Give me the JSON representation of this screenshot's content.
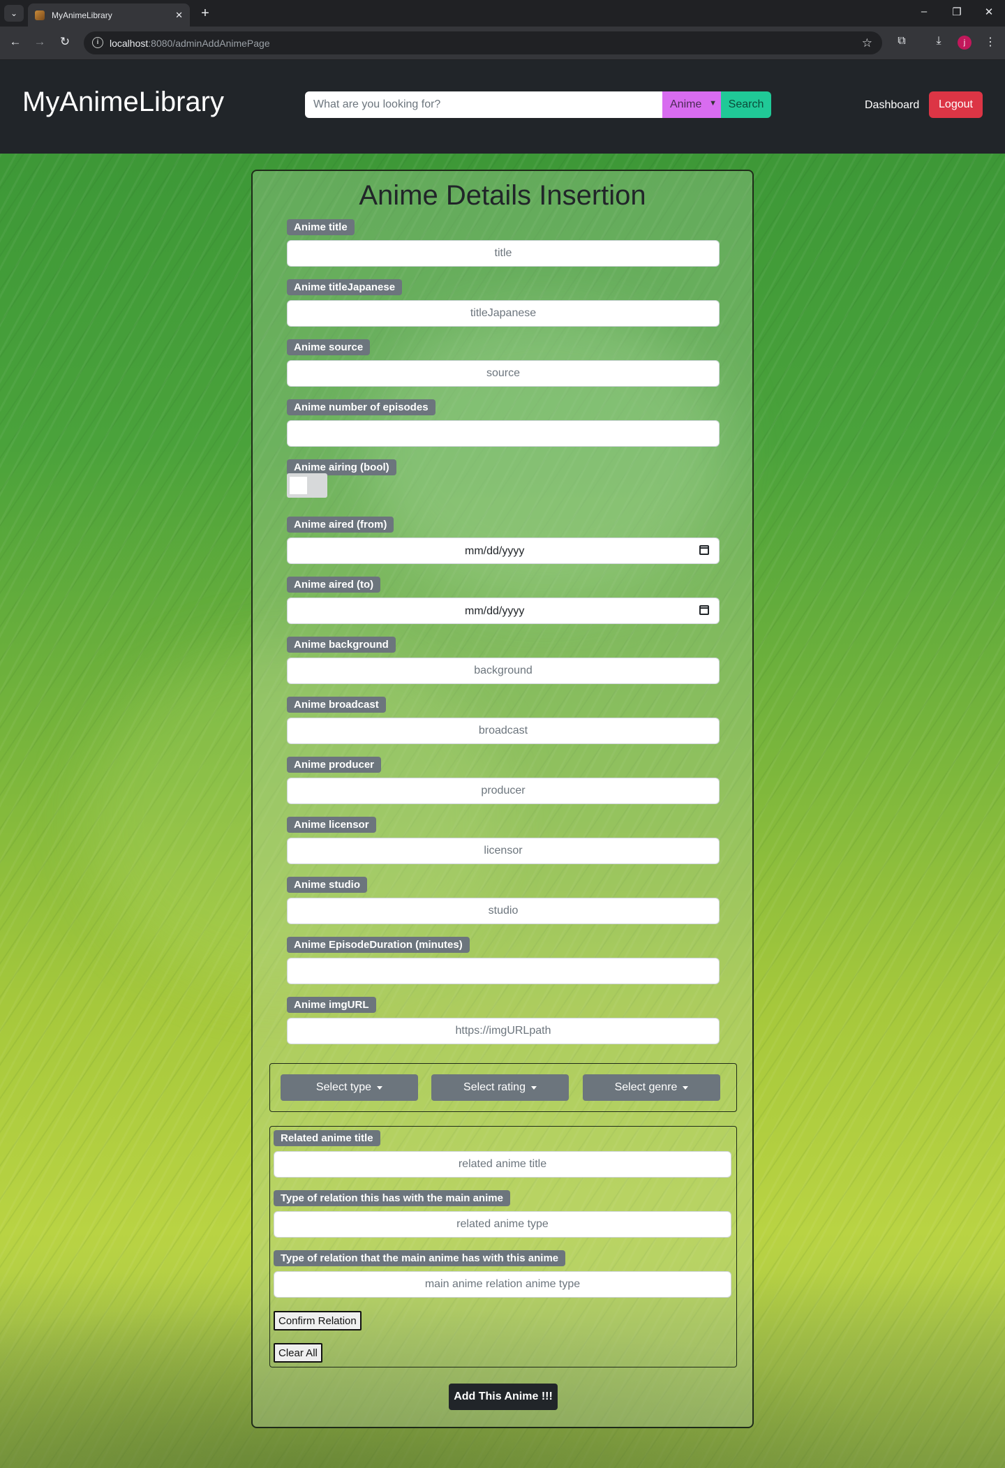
{
  "browser": {
    "tab_title": "MyAnimeLibrary",
    "url_host": "localhost",
    "url_rest": ":8080/adminAddAnimePage",
    "profile_initial": "j"
  },
  "header": {
    "brand": "MyAnimeLibrary",
    "search_placeholder": "What are you looking for?",
    "search_category": "Anime",
    "search_button": "Search",
    "dashboard_link": "Dashboard",
    "logout_button": "Logout"
  },
  "form": {
    "title": "Anime Details Insertion",
    "fields": [
      {
        "label": "Anime title",
        "placeholder": "title"
      },
      {
        "label": "Anime titleJapanese",
        "placeholder": "titleJapanese"
      },
      {
        "label": "Anime source",
        "placeholder": "source"
      },
      {
        "label": "Anime number of episodes",
        "placeholder": ""
      },
      {
        "label": "Anime airing (bool)"
      },
      {
        "label": "Anime aired (from)",
        "value": "mm/dd/yyyy"
      },
      {
        "label": "Anime aired (to)",
        "value": "mm/dd/yyyy"
      },
      {
        "label": "Anime background",
        "placeholder": "background"
      },
      {
        "label": "Anime broadcast",
        "placeholder": "broadcast"
      },
      {
        "label": "Anime producer",
        "placeholder": "producer"
      },
      {
        "label": "Anime licensor",
        "placeholder": "licensor"
      },
      {
        "label": "Anime studio",
        "placeholder": "studio"
      },
      {
        "label": "Anime EpisodeDuration (minutes)",
        "placeholder": ""
      },
      {
        "label": "Anime imgURL",
        "placeholder": "https://imgURLpath"
      }
    ],
    "airing_toggle_on": false,
    "dropdowns": [
      "Select type",
      "Select rating",
      "Select genre"
    ],
    "relation": {
      "fields": [
        {
          "label": "Related anime title",
          "placeholder": "related anime title"
        },
        {
          "label": "Type of relation this has with the main anime",
          "placeholder": "related anime type"
        },
        {
          "label": "Type of relation that the main anime has with this anime",
          "placeholder": "main anime relation anime type"
        }
      ],
      "confirm_button": "Confirm Relation",
      "clear_button": "Clear All"
    },
    "submit_button": "Add This Anime !!!"
  }
}
